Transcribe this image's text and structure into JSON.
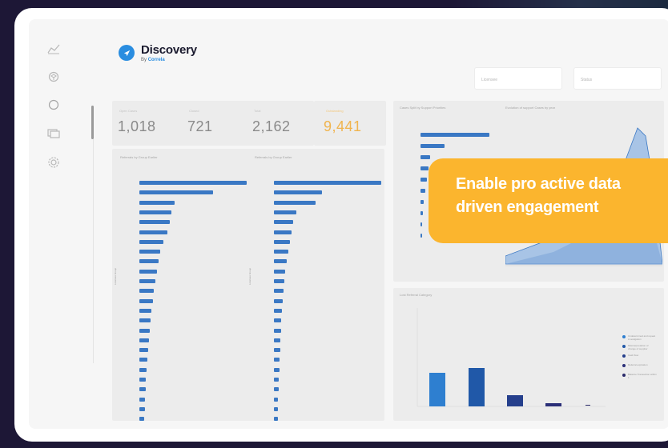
{
  "brand": {
    "title": "Discovery",
    "sub_prefix": "By",
    "sub_brand": "Correla"
  },
  "filters": [
    {
      "label": "Licensee"
    },
    {
      "label": "Status"
    }
  ],
  "kpis": [
    {
      "label": "Open Cases",
      "value": "1,018"
    },
    {
      "label": "Closed",
      "value": "721"
    },
    {
      "label": "Total",
      "value": "2,162"
    },
    {
      "label": "Outstanding",
      "value": "9,441",
      "color": "#f0b44e"
    }
  ],
  "charts": {
    "left_title": "Referrals by Group Earlier",
    "mid_title": "Referrals by Group Earlier",
    "top_right_title": "Cases Split by Support Priorities",
    "area_title": "Evolution of support Cases by year",
    "bottom_right_title": "Lost Referral Category",
    "left_axis": "Licensee Group",
    "mid_axis": "Licensee Group"
  },
  "callout": {
    "text": "Enable pro active data\ndriven engagement"
  },
  "legend": [
    {
      "label": "Undetermined and repeat investigation",
      "color": "#2e7fd0"
    },
    {
      "label": "Misinterpretation of change of supplier",
      "color": "#2058a8"
    },
    {
      "label": "Cash flow",
      "color": "#253f8c"
    },
    {
      "label": "Referral expiration",
      "color": "#2b2f78"
    },
    {
      "label": "Balance Transaction within 1",
      "color": "#2a2a6a"
    }
  ],
  "icons": {
    "trend": "chart-trend-icon",
    "cube": "cube-icon",
    "circle": "circle-icon",
    "folders": "folders-icon",
    "settings": "gear-icon",
    "logo": "paper-plane-icon"
  },
  "colors": {
    "accent": "#2a8de0",
    "bar": "#3a78c4",
    "callout": "#fbb52e",
    "background": "#1d1736"
  }
}
